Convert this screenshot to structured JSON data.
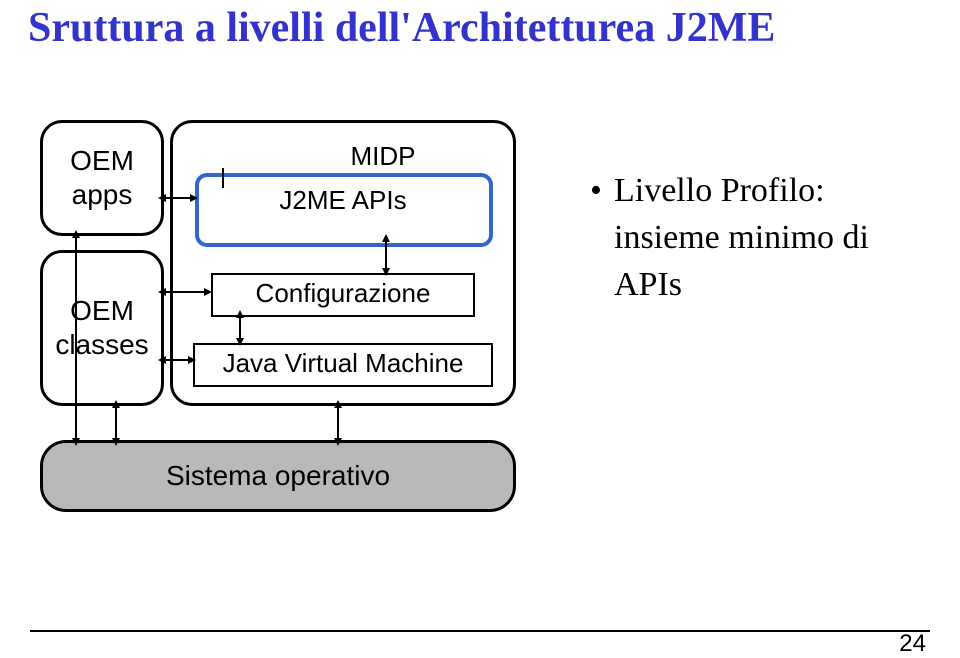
{
  "title": "Sruttura a livelli dell'Architetturea J2ME",
  "left": {
    "oem_apps_l1": "OEM",
    "oem_apps_l2": "apps",
    "oem_classes_l1": "OEM",
    "oem_classes_l2": "classes"
  },
  "right": {
    "midp": "MIDP",
    "j2me_apis": "J2ME APIs",
    "configurazione": "Configurazione",
    "jvm": "Java Virtual Machine"
  },
  "os": "Sistema operativo",
  "bullets": {
    "line1": "Livello Profilo:",
    "line2": "insieme minimo di",
    "line3": "APIs"
  },
  "slide": "24"
}
